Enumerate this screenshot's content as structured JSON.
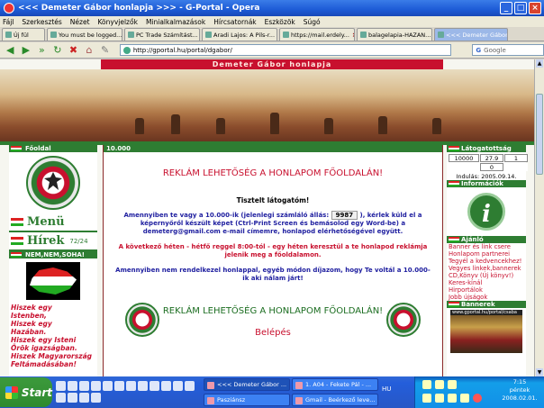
{
  "window": {
    "title": "<<< Demeter Gábor honlapja >>> - G-Portal - Opera"
  },
  "menu": [
    "Fájl",
    "Szerkesztés",
    "Nézet",
    "Könyvjelzők",
    "Minialkalmazások",
    "Hírcsatornák",
    "Eszközök",
    "Súgó"
  ],
  "tabs": [
    {
      "label": "Új fül",
      "active": false
    },
    {
      "label": "You must be logged...",
      "active": false
    },
    {
      "label": "PC Trade Számítást...",
      "active": false
    },
    {
      "label": "Aradi Lajos: A Pils-r...",
      "active": false
    },
    {
      "label": "https://mail.erdely...",
      "active": false
    },
    {
      "label": "balagelapia-HAZAN...",
      "active": false
    },
    {
      "label": "<<< Demeter Gábor...",
      "active": true
    }
  ],
  "address": {
    "url": "http://gportal.hu/portal/dgabor/",
    "search_placeholder": "Google",
    "search_engine": "G"
  },
  "page": {
    "banner_title": "Demeter Gábor honlapja",
    "left": {
      "header_fooldal": "Főoldal",
      "menu_label": "Menü",
      "hirek_label": "Hírek",
      "hirek_count": "72/24",
      "nem_header": "NEM,NEM,SOHA!",
      "poem": [
        "Hiszek egy",
        "Istenben,",
        "Hiszek egy",
        "Hazában.",
        "Hiszek egy Isteni",
        "Örök igazságban.",
        "Hiszek Magyarország",
        "Feltámadásában!"
      ]
    },
    "center": {
      "header": "10.000",
      "ad_top": "REKLÁM LEHETŐSÉG A HONLAPOM FŐOLDALÁN!",
      "greeting": "Tisztelt látogatóm!",
      "para1_a": "Amennyiben te vagy a 10.000-ik (jelenlegi számláló állás:",
      "counter": "9987",
      "para1_b": "), kérlek küld el a képernyőről készült képet (Ctrl-Print Screen és bemásolod egy Word-be) a demeterg@gmail.com e-mail címemre, honlapod elérhetőségével együtt.",
      "para2": "A következő héten - hétfő reggel 8:00-tól - egy héten keresztül a te honlapod reklámja jelenik meg a főoldalamon.",
      "para3": "Amennyiben nem rendelkezel honlappal, egyéb módon díjazom, hogy Te voltál a 10.000-ik aki nálam járt!",
      "ad_bottom": "REKLÁM LEHETŐSÉG A HONLAPOM FŐOLDALÁN!",
      "login": "Belépés"
    },
    "right": {
      "visitors_header": "Látogatottság",
      "stats": [
        "10000",
        "27.9",
        "1",
        "",
        "0",
        ""
      ],
      "since": "Indulás: 2005.09.14.",
      "info_header": "Információk",
      "info_glyph": "i",
      "ajanlo_header": "Ajánló",
      "links": [
        "Banner és link csere",
        "Honlapom partnerei",
        "Tegyél a kedvencekhez!",
        "Vegyes linkek,bannerek",
        "CD,Könyv (Új könyv!)",
        "Keres-kínál",
        "Hirportálok",
        "Jobb újságok"
      ],
      "bannerek_header": "Bannerek",
      "banner_caption": "www.gportal.hu/portal/csaba"
    }
  },
  "taskbar": {
    "start": "Start",
    "buttons": [
      {
        "label": "<<< Demeter Gábor ...",
        "active": true
      },
      {
        "label": "1. A04 - Fekete Pál - ...",
        "active": false
      },
      {
        "label": "Pasziánsz",
        "active": false
      },
      {
        "label": "Gmail - Beérkező leve...",
        "active": false
      }
    ],
    "lang": "HU",
    "time": "7:15",
    "day": "péntek",
    "date": "2008.02.01."
  }
}
